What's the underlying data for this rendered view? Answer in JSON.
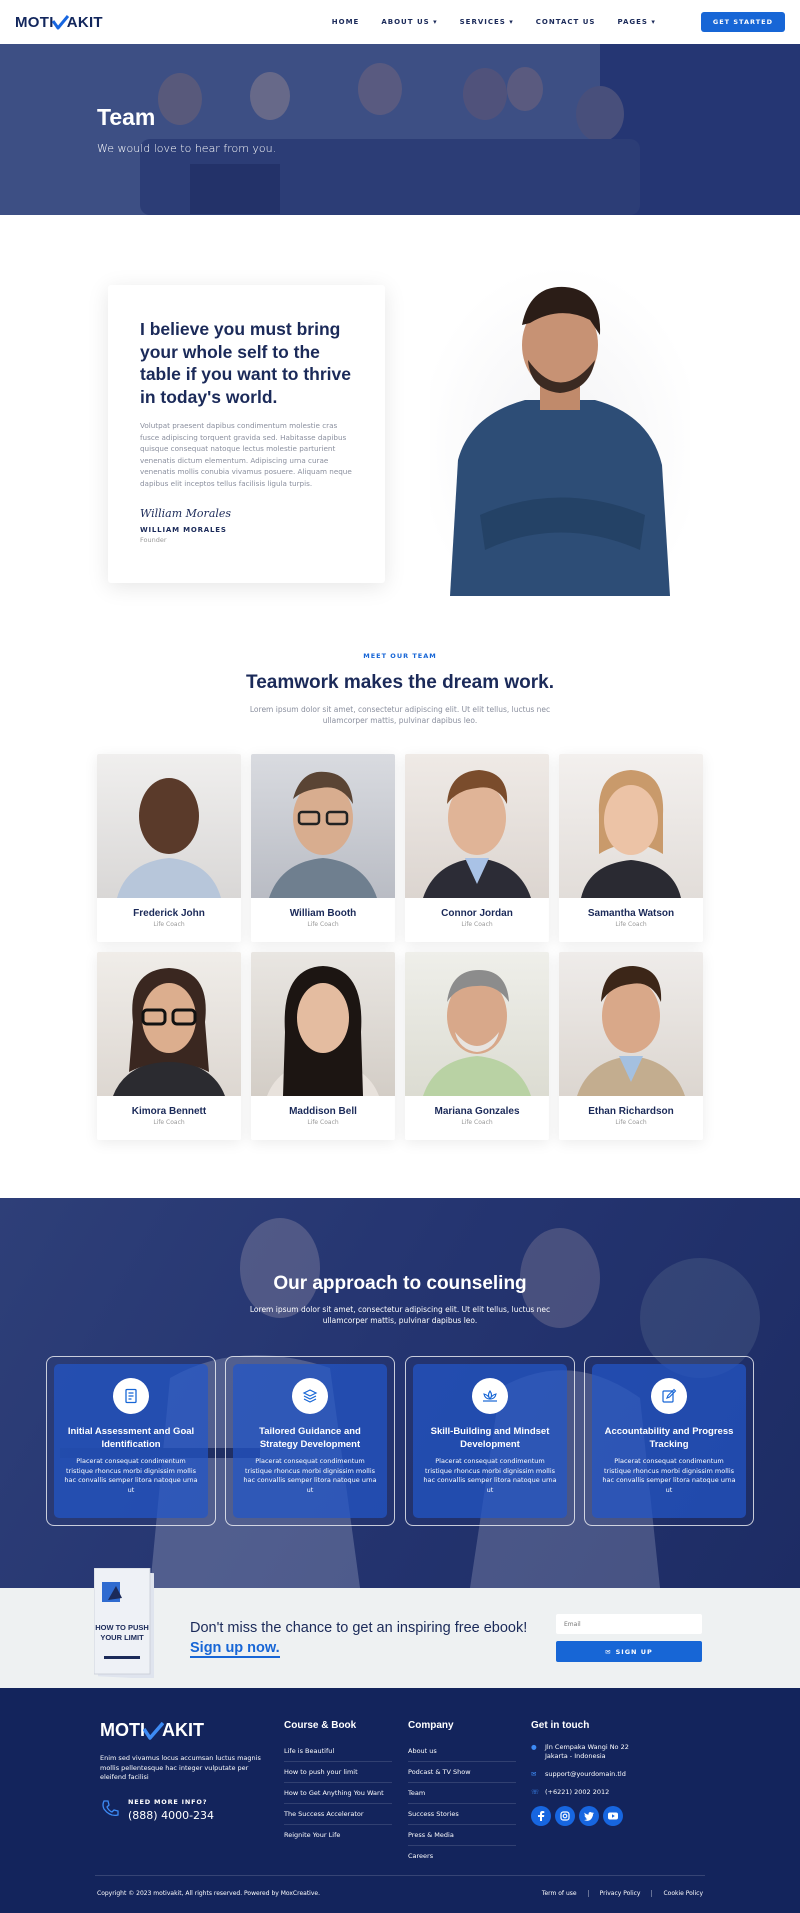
{
  "header": {
    "logo_pre": "MOTI",
    "logo_post": "AKIT",
    "nav": [
      "HOME",
      "ABOUT US",
      "SERVICES",
      "CONTACT US",
      "PAGES"
    ],
    "cta": "GET STARTED"
  },
  "hero": {
    "title": "Team",
    "subtitle": "We would love to hear from you."
  },
  "quote": {
    "heading": "I believe you must bring your whole self to the table if you want to thrive in today's world.",
    "text": "Volutpat praesent dapibus condimentum molestie cras fusce adipiscing torquent gravida sed. Habitasse dapibus quisque consequat natoque lectus molestie parturient venenatis dictum elementum. Adipiscing urna curae venenatis mollis conubia vivamus posuere. Aliquam neque dapibus elit inceptos tellus facilisis ligula turpis.",
    "signature": "William Morales",
    "name": "WILLIAM MORALES",
    "role": "Founder"
  },
  "team": {
    "eyebrow": "MEET OUR TEAM",
    "heading": "Teamwork makes the dream work.",
    "text": "Lorem ipsum dolor sit amet, consectetur adipiscing elit. Ut elit tellus, luctus nec ullamcorper mattis, pulvinar dapibus leo.",
    "members": [
      {
        "name": "Frederick John",
        "role": "Life Coach"
      },
      {
        "name": "William Booth",
        "role": "Life Coach"
      },
      {
        "name": "Connor Jordan",
        "role": "Life Coach"
      },
      {
        "name": "Samantha Watson",
        "role": "Life Coach"
      },
      {
        "name": "Kimora Bennett",
        "role": "Life Coach"
      },
      {
        "name": "Maddison Bell",
        "role": "Life Coach"
      },
      {
        "name": "Mariana Gonzales",
        "role": "Life Coach"
      },
      {
        "name": "Ethan Richardson",
        "role": "Life Coach"
      }
    ]
  },
  "approach": {
    "heading": "Our approach to counseling",
    "text": "Lorem ipsum dolor sit amet, consectetur adipiscing elit. Ut elit tellus, luctus nec ullamcorper mattis, pulvinar dapibus leo.",
    "cards": [
      {
        "title": "Initial Assessment and Goal Identification",
        "text": "Placerat consequat condimentum tristique rhoncus morbi dignissim mollis hac convallis semper litora natoque urna ut",
        "icon": "document-icon"
      },
      {
        "title": "Tailored Guidance and Strategy Development",
        "text": "Placerat consequat condimentum tristique rhoncus morbi dignissim mollis hac convallis semper litora natoque urna ut",
        "icon": "layers-icon"
      },
      {
        "title": "Skill-Building and Mindset Development",
        "text": "Placerat consequat condimentum tristique rhoncus morbi dignissim mollis hac convallis semper litora natoque urna ut",
        "icon": "lotus-icon"
      },
      {
        "title": "Accountability and Progress Tracking",
        "text": "Placerat consequat condimentum tristique rhoncus morbi dignissim mollis hac convallis semper litora natoque urna ut",
        "icon": "edit-icon"
      }
    ]
  },
  "ebook": {
    "book_title": "HOW TO PUSH YOUR LIMIT",
    "text": "Don't miss the chance to get an inspiring free ebook!",
    "signup_link": "Sign up now.",
    "email_placeholder": "Email",
    "button": "SIGN UP"
  },
  "footer": {
    "logo_pre": "MOTI",
    "logo_post": "AKIT",
    "desc": "Enim sed vivamus locus accumsan luctus magnis mollis pellentesque hac integer vulputate per eleifend facilisi",
    "need_more": "NEED MORE INFO?",
    "phone": "(888) 4000-234",
    "course": {
      "title": "Course & Book",
      "links": [
        "Life is Beautiful",
        "How to push your limit",
        "How to Get Anything You Want",
        "The Success Accelerator",
        "Reignite Your Life"
      ]
    },
    "company": {
      "title": "Company",
      "links": [
        "About us",
        "Podcast & TV Show",
        "Team",
        "Success Stories",
        "Press & Media",
        "Careers"
      ]
    },
    "contact": {
      "title": "Get in touch",
      "address1": "Jln Cempaka Wangi No 22",
      "address2": "Jakarta - Indonesia",
      "email": "support@yourdomain.tld",
      "phone": "(+6221) 2002 2012"
    },
    "copyright": "Copyright © 2023 motivakit, All rights reserved. Powered by MoxCreative.",
    "legal": [
      "Term of use",
      "Privacy Policy",
      "Cookie Policy"
    ]
  },
  "colors": {
    "navy": "#13245c",
    "accent": "#1766d6",
    "text": "#1b2a59"
  }
}
